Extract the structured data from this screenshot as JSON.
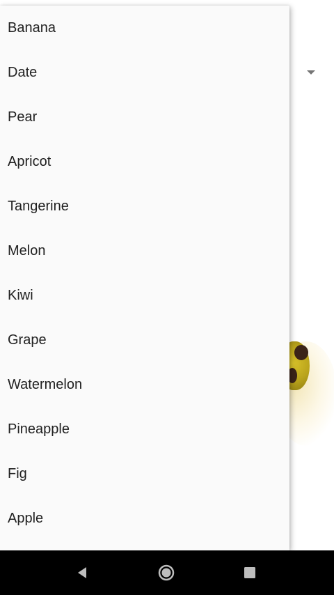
{
  "spinner": {
    "arrow_icon": "dropdown-arrow-icon",
    "items": [
      {
        "label": "Banana"
      },
      {
        "label": "Date"
      },
      {
        "label": "Pear"
      },
      {
        "label": "Apricot"
      },
      {
        "label": "Tangerine"
      },
      {
        "label": "Melon"
      },
      {
        "label": "Kiwi"
      },
      {
        "label": "Grape"
      },
      {
        "label": "Watermelon"
      },
      {
        "label": "Pineapple"
      },
      {
        "label": "Fig"
      },
      {
        "label": "Apple"
      }
    ]
  },
  "navbar": {
    "back_icon": "back-icon",
    "home_icon": "home-icon",
    "recents_icon": "recents-icon",
    "color": "#bdbdbd",
    "background": "#000000"
  }
}
